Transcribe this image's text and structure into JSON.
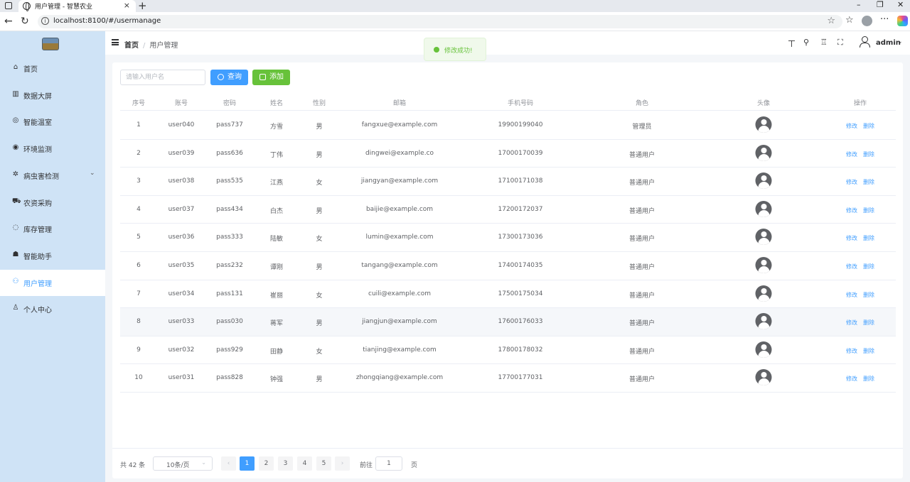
{
  "browser": {
    "tab_title": "用户管理 - 智慧农业",
    "tab_close": "×",
    "new_tab": "+",
    "url": "localhost:8100/#/usermanage",
    "win_min": "–",
    "win_max": "❐",
    "win_close": "✕",
    "back": "←",
    "reload": "↻",
    "star": "☆",
    "favorites": "☆",
    "more": "···"
  },
  "sidebar": {
    "items": [
      {
        "label": "首页",
        "icon": "home-icon",
        "glyph": "⌂"
      },
      {
        "label": "数据大屏",
        "icon": "chart-icon",
        "glyph": "▥"
      },
      {
        "label": "智能温室",
        "icon": "greenhouse-icon",
        "glyph": "◎"
      },
      {
        "label": "环境监测",
        "icon": "monitor-icon",
        "glyph": "◉"
      },
      {
        "label": "病虫害检测",
        "icon": "bug-icon",
        "glyph": "✲",
        "arrow": "⌄"
      },
      {
        "label": "农资采购",
        "icon": "cart-icon",
        "glyph": "⛟"
      },
      {
        "label": "库存管理",
        "icon": "box-icon",
        "glyph": "◌"
      },
      {
        "label": "智能助手",
        "icon": "robot-icon",
        "glyph": "☗"
      },
      {
        "label": "用户管理",
        "icon": "users-icon",
        "glyph": "⚇",
        "active": true
      },
      {
        "label": "个人中心",
        "icon": "user-icon",
        "glyph": "♙"
      }
    ]
  },
  "header": {
    "crumb_home": "首页",
    "crumb_sep": "/",
    "crumb_current": "用户管理",
    "icons": [
      "translate-icon",
      "search-icon",
      "theme-icon",
      "fullscreen-icon"
    ],
    "icon_glyphs": [
      "ㄒ",
      "⚲",
      "♖",
      "⛶"
    ],
    "user": "admin",
    "caret": "⌄"
  },
  "toast": {
    "text": "修改成功!"
  },
  "toolbar": {
    "search_placeholder": "请输入用户名",
    "search_btn": "查询",
    "add_btn": "添加"
  },
  "table": {
    "headers": [
      "序号",
      "账号",
      "密码",
      "姓名",
      "性别",
      "邮箱",
      "手机号码",
      "角色",
      "头像",
      "操作"
    ],
    "action_edit": "修改",
    "action_delete": "删除",
    "rows": [
      {
        "no": "1",
        "account": "user040",
        "password": "pass737",
        "name": "方雪",
        "gender": "男",
        "email": "fangxue@example.com",
        "phone": "19900199040",
        "role": "管理员"
      },
      {
        "no": "2",
        "account": "user039",
        "password": "pass636",
        "name": "丁伟",
        "gender": "男",
        "email": "dingwei@example.co",
        "phone": "17000170039",
        "role": "普通用户"
      },
      {
        "no": "3",
        "account": "user038",
        "password": "pass535",
        "name": "江燕",
        "gender": "女",
        "email": "jiangyan@example.com",
        "phone": "17100171038",
        "role": "普通用户"
      },
      {
        "no": "4",
        "account": "user037",
        "password": "pass434",
        "name": "白杰",
        "gender": "男",
        "email": "baijie@example.com",
        "phone": "17200172037",
        "role": "普通用户"
      },
      {
        "no": "5",
        "account": "user036",
        "password": "pass333",
        "name": "陆敏",
        "gender": "女",
        "email": "lumin@example.com",
        "phone": "17300173036",
        "role": "普通用户"
      },
      {
        "no": "6",
        "account": "user035",
        "password": "pass232",
        "name": "谭刚",
        "gender": "男",
        "email": "tangang@example.com",
        "phone": "17400174035",
        "role": "普通用户"
      },
      {
        "no": "7",
        "account": "user034",
        "password": "pass131",
        "name": "崔丽",
        "gender": "女",
        "email": "cuili@example.com",
        "phone": "17500175034",
        "role": "普通用户"
      },
      {
        "no": "8",
        "account": "user033",
        "password": "pass030",
        "name": "蒋军",
        "gender": "男",
        "email": "jiangjun@example.com",
        "phone": "17600176033",
        "role": "普通用户"
      },
      {
        "no": "9",
        "account": "user032",
        "password": "pass929",
        "name": "田静",
        "gender": "女",
        "email": "tianjing@example.com",
        "phone": "17800178032",
        "role": "普通用户"
      },
      {
        "no": "10",
        "account": "user031",
        "password": "pass828",
        "name": "钟强",
        "gender": "男",
        "email": "zhongqiang@example.com",
        "phone": "17700177031",
        "role": "普通用户"
      }
    ]
  },
  "pagination": {
    "total": "共 42 条",
    "page_size": "10条/页",
    "size_caret": "⌄",
    "prev": "‹",
    "next": "›",
    "pages": [
      "1",
      "2",
      "3",
      "4",
      "5"
    ],
    "current": "1",
    "goto_prefix": "前往",
    "goto_value": "1",
    "goto_suffix": "页"
  }
}
